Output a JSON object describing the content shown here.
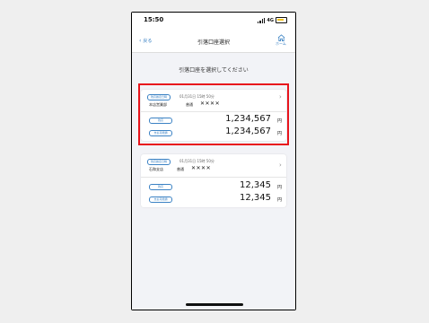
{
  "status": {
    "time": "15:50",
    "network": "4G"
  },
  "nav": {
    "back_label": "戻る",
    "title": "引落口座選択",
    "home_label": "ホーム"
  },
  "instruction": "引落口座を選択してください",
  "accounts": [
    {
      "confirm_tag": "残高確定日時",
      "datetime": "01月31日 15時 50分",
      "branch": "本店営業部",
      "type": "普通",
      "number": "✕✕✕✕",
      "balance_label": "残高",
      "balance": "1,234,567",
      "available_label": "支払可能額",
      "available": "1,234,567",
      "currency": "円"
    },
    {
      "confirm_tag": "残高確定日時",
      "datetime": "01月31日 15時 50分",
      "branch": "石和支店",
      "type": "普通",
      "number": "✕✕✕✕",
      "balance_label": "残高",
      "balance": "12,345",
      "available_label": "支払可能額",
      "available": "12,345",
      "currency": "円"
    }
  ],
  "colors": {
    "accent": "#3b82c4",
    "highlight": "#e8141c",
    "battery": "#f1c21b"
  }
}
